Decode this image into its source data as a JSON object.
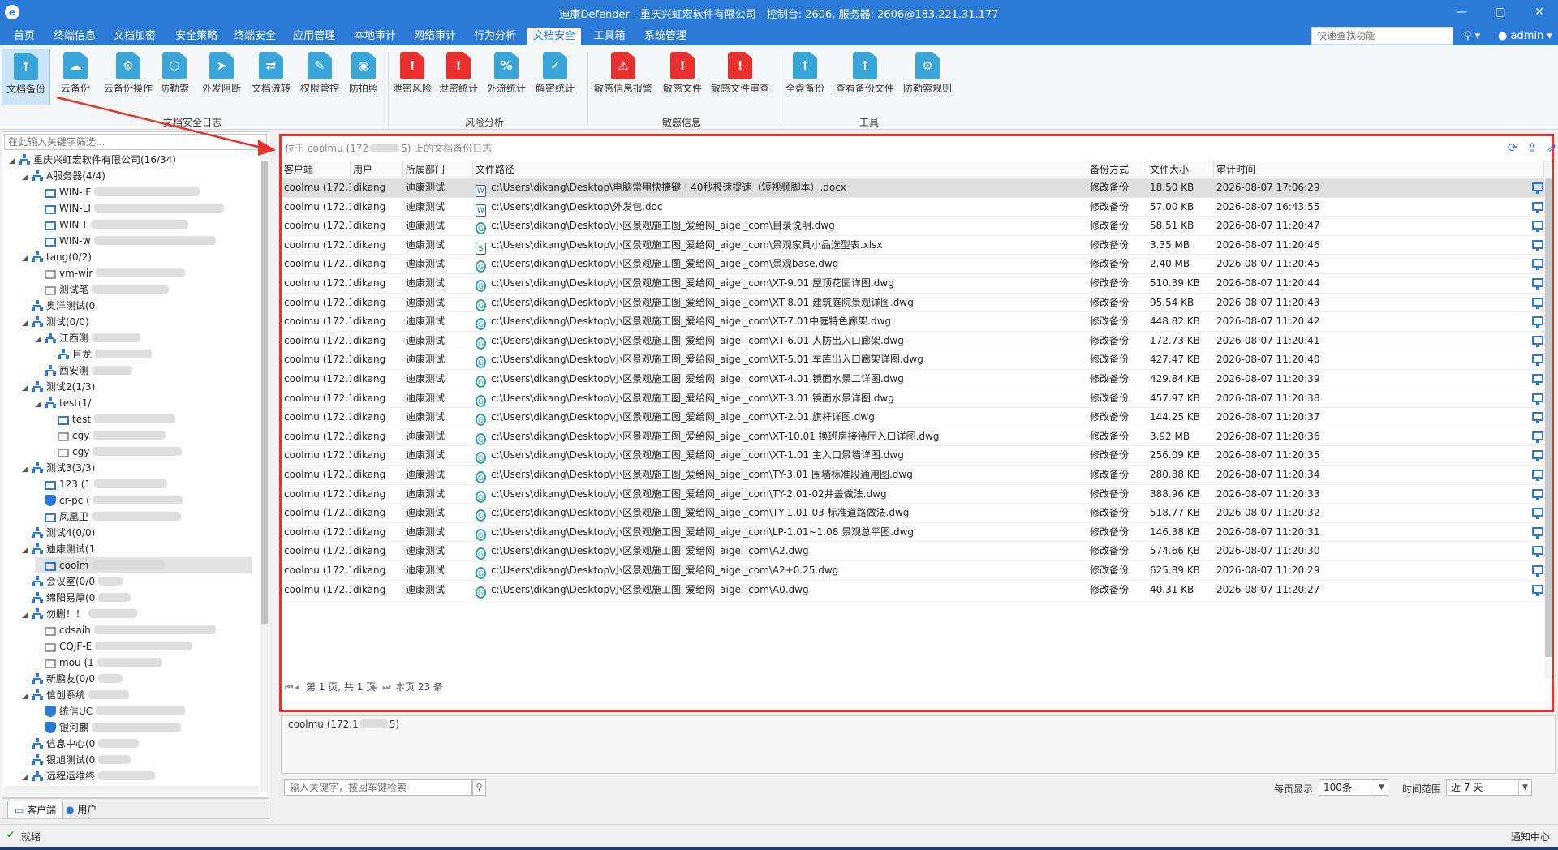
{
  "window": {
    "title": "迪康Defender - 重庆兴虹宏软件有限公司 - 控制台: 2606, 服务器: 2606@183.221.31.177"
  },
  "menu": {
    "items": [
      "首页",
      "终端信息",
      "文档加密",
      "安全策略",
      "终端安全",
      "应用管理",
      "本地审计",
      "网络审计",
      "行为分析",
      "文档安全",
      "工具箱",
      "系统管理"
    ],
    "active_index": 9,
    "quick_search_placeholder": "快速查找功能",
    "user": "admin"
  },
  "ribbon": {
    "groups": [
      {
        "label": "文档安全日志",
        "buttons": [
          "文档备份",
          "云备份",
          "云备份操作",
          "防勒索",
          "外发阻断",
          "文档流转",
          "权限管控",
          "防拍照"
        ]
      },
      {
        "label": "风险分析",
        "buttons": [
          "泄密风险",
          "泄密统计",
          "外流统计",
          "解密统计"
        ]
      },
      {
        "label": "敏感信息",
        "buttons": [
          "敏感信息报警",
          "敏感文件",
          "敏感文件审查"
        ]
      },
      {
        "label": "工具",
        "buttons": [
          "全盘备份",
          "查看备份文件",
          "防勒索规则"
        ]
      }
    ],
    "active_button": "文档备份",
    "colors": {
      "accent": "#2b79d6",
      "alert": "#e8312f",
      "teal": "#3aa5d8"
    }
  },
  "tree": {
    "filter_placeholder": "在此输入关键字筛选...",
    "nodes": [
      {
        "label": "重庆兴虹宏软件有限公司(16/34)",
        "level": 0,
        "type": "org",
        "toggle": "▲"
      },
      {
        "label": "A服务器(4/4)",
        "level": 1,
        "type": "org",
        "toggle": "▲"
      },
      {
        "label": "WIN-IF",
        "level": 2,
        "type": "pc"
      },
      {
        "label": "WIN-LI",
        "level": 2,
        "type": "pc"
      },
      {
        "label": "WIN-T",
        "level": 2,
        "type": "pc"
      },
      {
        "label": "WIN-w",
        "level": 2,
        "type": "pc"
      },
      {
        "label": "tang(0/2)",
        "level": 1,
        "type": "org",
        "toggle": "▲"
      },
      {
        "label": "vm-wir",
        "level": 2,
        "type": "pc-off"
      },
      {
        "label": "测试笔",
        "level": 2,
        "type": "pc-off"
      },
      {
        "label": "奥洋测试(0",
        "level": 1,
        "type": "org"
      },
      {
        "label": "测试(0/0)",
        "level": 1,
        "type": "org",
        "toggle": "▲"
      },
      {
        "label": "江西测",
        "level": 2,
        "type": "org",
        "toggle": "▲"
      },
      {
        "label": "巨龙",
        "level": 3,
        "type": "org"
      },
      {
        "label": "西安测",
        "level": 2,
        "type": "org"
      },
      {
        "label": "测试2(1/3)",
        "level": 1,
        "type": "org",
        "toggle": "▲"
      },
      {
        "label": "test(1/",
        "level": 2,
        "type": "org",
        "toggle": "▲"
      },
      {
        "label": "test",
        "level": 3,
        "type": "pc"
      },
      {
        "label": "cgy",
        "level": 3,
        "type": "pc-off"
      },
      {
        "label": "cgy",
        "level": 3,
        "type": "pc-off"
      },
      {
        "label": "测试3(3/3)",
        "level": 1,
        "type": "org",
        "toggle": "▲"
      },
      {
        "label": "123 (1",
        "level": 2,
        "type": "pc"
      },
      {
        "label": "cr-pc (",
        "level": 2,
        "type": "shield"
      },
      {
        "label": "凤凰卫",
        "level": 2,
        "type": "pc"
      },
      {
        "label": "测试4(0/0)",
        "level": 1,
        "type": "org"
      },
      {
        "label": "迪康测试(1",
        "level": 1,
        "type": "org",
        "toggle": "▲"
      },
      {
        "label": "coolm",
        "level": 2,
        "type": "pc",
        "selected": true
      },
      {
        "label": "会议室(0/0",
        "level": 1,
        "type": "org"
      },
      {
        "label": "绵阳易厚(0",
        "level": 1,
        "type": "org"
      },
      {
        "label": "勿删！！",
        "level": 1,
        "type": "org",
        "toggle": "▲"
      },
      {
        "label": "cdsaih",
        "level": 2,
        "type": "pc-off"
      },
      {
        "label": "CQJF-E",
        "level": 2,
        "type": "pc-off"
      },
      {
        "label": "mou (1",
        "level": 2,
        "type": "pc-off"
      },
      {
        "label": "新鹏友(0/0",
        "level": 1,
        "type": "org"
      },
      {
        "label": "信创系统",
        "level": 1,
        "type": "org",
        "toggle": "▲"
      },
      {
        "label": "统信UC",
        "level": 2,
        "type": "shield"
      },
      {
        "label": "银河麒",
        "level": 2,
        "type": "shield"
      },
      {
        "label": "信息中心(0",
        "level": 1,
        "type": "org"
      },
      {
        "label": "银旭测试(0",
        "level": 1,
        "type": "org"
      },
      {
        "label": "远程运维终",
        "level": 1,
        "type": "org",
        "toggle": "▲"
      }
    ]
  },
  "left_tabs": [
    "客户端",
    "用户"
  ],
  "grid": {
    "caption_left": "位于 coolmu (172",
    "caption_right": "5) 上的文档备份日志",
    "columns": [
      "客户端",
      "用户",
      "所属部门",
      "文件路径",
      "备份方式",
      "文件大小",
      "审计时间"
    ],
    "rows": [
      {
        "client": "coolmu (172.1...",
        "user": "dikang",
        "dept": "迪康测试",
        "ft": "w",
        "path": "c:\\Users\\dikang\\Desktop\\电脑常用快捷键｜40秒极速提速（短视频脚本）.docx",
        "mode": "修改备份",
        "size": "18.50 KB",
        "time": "2026-08-07 17:06:29"
      },
      {
        "client": "coolmu (172.1...",
        "user": "dikang",
        "dept": "迪康测试",
        "ft": "w",
        "path": "c:\\Users\\dikang\\Desktop\\外发包.doc",
        "mode": "修改备份",
        "size": "57.00 KB",
        "time": "2026-08-07 16:43:55"
      },
      {
        "client": "coolmu (172.1...",
        "user": "dikang",
        "dept": "迪康测试",
        "ft": "d",
        "path": "c:\\Users\\dikang\\Desktop\\小区景观施工图_爱给网_aigei_com\\目录说明.dwg",
        "mode": "修改备份",
        "size": "58.51 KB",
        "time": "2026-08-07 11:20:47"
      },
      {
        "client": "coolmu (172.1...",
        "user": "dikang",
        "dept": "迪康测试",
        "ft": "x",
        "path": "c:\\Users\\dikang\\Desktop\\小区景观施工图_爱给网_aigei_com\\景观家具小品选型表.xlsx",
        "mode": "修改备份",
        "size": "3.35 MB",
        "time": "2026-08-07 11:20:46"
      },
      {
        "client": "coolmu (172.1...",
        "user": "dikang",
        "dept": "迪康测试",
        "ft": "d",
        "path": "c:\\Users\\dikang\\Desktop\\小区景观施工图_爱给网_aigei_com\\景观base.dwg",
        "mode": "修改备份",
        "size": "2.40 MB",
        "time": "2026-08-07 11:20:45"
      },
      {
        "client": "coolmu (172.1...",
        "user": "dikang",
        "dept": "迪康测试",
        "ft": "d",
        "path": "c:\\Users\\dikang\\Desktop\\小区景观施工图_爱给网_aigei_com\\XT-9.01 屋顶花园详图.dwg",
        "mode": "修改备份",
        "size": "510.39 KB",
        "time": "2026-08-07 11:20:44"
      },
      {
        "client": "coolmu (172.1...",
        "user": "dikang",
        "dept": "迪康测试",
        "ft": "d",
        "path": "c:\\Users\\dikang\\Desktop\\小区景观施工图_爱给网_aigei_com\\XT-8.01 建筑庭院景观详图.dwg",
        "mode": "修改备份",
        "size": "95.54 KB",
        "time": "2026-08-07 11:20:43"
      },
      {
        "client": "coolmu (172.1...",
        "user": "dikang",
        "dept": "迪康测试",
        "ft": "d",
        "path": "c:\\Users\\dikang\\Desktop\\小区景观施工图_爱给网_aigei_com\\XT-7.01中庭特色廊架.dwg",
        "mode": "修改备份",
        "size": "448.82 KB",
        "time": "2026-08-07 11:20:42"
      },
      {
        "client": "coolmu (172.1...",
        "user": "dikang",
        "dept": "迪康测试",
        "ft": "d",
        "path": "c:\\Users\\dikang\\Desktop\\小区景观施工图_爱给网_aigei_com\\XT-6.01 人防出入口廊架.dwg",
        "mode": "修改备份",
        "size": "172.73 KB",
        "time": "2026-08-07 11:20:41"
      },
      {
        "client": "coolmu (172.1...",
        "user": "dikang",
        "dept": "迪康测试",
        "ft": "d",
        "path": "c:\\Users\\dikang\\Desktop\\小区景观施工图_爱给网_aigei_com\\XT-5.01 车库出入口廊架详图.dwg",
        "mode": "修改备份",
        "size": "427.47 KB",
        "time": "2026-08-07 11:20:40"
      },
      {
        "client": "coolmu (172.1...",
        "user": "dikang",
        "dept": "迪康测试",
        "ft": "d",
        "path": "c:\\Users\\dikang\\Desktop\\小区景观施工图_爱给网_aigei_com\\XT-4.01 镜面水景二详图.dwg",
        "mode": "修改备份",
        "size": "429.84 KB",
        "time": "2026-08-07 11:20:39"
      },
      {
        "client": "coolmu (172.1...",
        "user": "dikang",
        "dept": "迪康测试",
        "ft": "d",
        "path": "c:\\Users\\dikang\\Desktop\\小区景观施工图_爱给网_aigei_com\\XT-3.01 镜面水景详图.dwg",
        "mode": "修改备份",
        "size": "457.97 KB",
        "time": "2026-08-07 11:20:38"
      },
      {
        "client": "coolmu (172.1...",
        "user": "dikang",
        "dept": "迪康测试",
        "ft": "d",
        "path": "c:\\Users\\dikang\\Desktop\\小区景观施工图_爱给网_aigei_com\\XT-2.01 旗杆详图.dwg",
        "mode": "修改备份",
        "size": "144.25 KB",
        "time": "2026-08-07 11:20:37"
      },
      {
        "client": "coolmu (172.1...",
        "user": "dikang",
        "dept": "迪康测试",
        "ft": "d",
        "path": "c:\\Users\\dikang\\Desktop\\小区景观施工图_爱给网_aigei_com\\XT-10.01 换班房接待厅入口详图.dwg",
        "mode": "修改备份",
        "size": "3.92 MB",
        "time": "2026-08-07 11:20:36"
      },
      {
        "client": "coolmu (172.1...",
        "user": "dikang",
        "dept": "迪康测试",
        "ft": "d",
        "path": "c:\\Users\\dikang\\Desktop\\小区景观施工图_爱给网_aigei_com\\XT-1.01 主入口景墙详图.dwg",
        "mode": "修改备份",
        "size": "256.09 KB",
        "time": "2026-08-07 11:20:35"
      },
      {
        "client": "coolmu (172.1...",
        "user": "dikang",
        "dept": "迪康测试",
        "ft": "d",
        "path": "c:\\Users\\dikang\\Desktop\\小区景观施工图_爱给网_aigei_com\\TY-3.01 围墙标准段通用图.dwg",
        "mode": "修改备份",
        "size": "280.88 KB",
        "time": "2026-08-07 11:20:34"
      },
      {
        "client": "coolmu (172.1...",
        "user": "dikang",
        "dept": "迪康测试",
        "ft": "d",
        "path": "c:\\Users\\dikang\\Desktop\\小区景观施工图_爱给网_aigei_com\\TY-2.01-02井盖做法.dwg",
        "mode": "修改备份",
        "size": "388.96 KB",
        "time": "2026-08-07 11:20:33"
      },
      {
        "client": "coolmu (172.1...",
        "user": "dikang",
        "dept": "迪康测试",
        "ft": "d",
        "path": "c:\\Users\\dikang\\Desktop\\小区景观施工图_爱给网_aigei_com\\TY-1.01-03 标准道路做法.dwg",
        "mode": "修改备份",
        "size": "518.77 KB",
        "time": "2026-08-07 11:20:32"
      },
      {
        "client": "coolmu (172.1...",
        "user": "dikang",
        "dept": "迪康测试",
        "ft": "d",
        "path": "c:\\Users\\dikang\\Desktop\\小区景观施工图_爱给网_aigei_com\\LP-1.01~1.08 景观总平图.dwg",
        "mode": "修改备份",
        "size": "146.38 KB",
        "time": "2026-08-07 11:20:31"
      },
      {
        "client": "coolmu (172.1...",
        "user": "dikang",
        "dept": "迪康测试",
        "ft": "d",
        "path": "c:\\Users\\dikang\\Desktop\\小区景观施工图_爱给网_aigei_com\\A2.dwg",
        "mode": "修改备份",
        "size": "574.66 KB",
        "time": "2026-08-07 11:20:30"
      },
      {
        "client": "coolmu (172.1...",
        "user": "dikang",
        "dept": "迪康测试",
        "ft": "d",
        "path": "c:\\Users\\dikang\\Desktop\\小区景观施工图_爱给网_aigei_com\\A2+0.25.dwg",
        "mode": "修改备份",
        "size": "625.89 KB",
        "time": "2026-08-07 11:20:29"
      },
      {
        "client": "coolmu (172.1...",
        "user": "dikang",
        "dept": "迪康测试",
        "ft": "d",
        "path": "c:\\Users\\dikang\\Desktop\\小区景观施工图_爱给网_aigei_com\\A0.dwg",
        "mode": "修改备份",
        "size": "40.31 KB",
        "time": "2026-08-07 11:20:27"
      }
    ]
  },
  "pager": {
    "page_text": "第 1 页, 共 1 页",
    "count_text": "本页 23 条"
  },
  "detail": {
    "text_left": "coolmu (172.1",
    "text_right": "5)"
  },
  "bottom": {
    "keyword_placeholder": "输入关键字，按回车键检索",
    "per_page_label": "每页显示",
    "per_page_value": "100条",
    "range_label": "时间范围",
    "range_value": "近 7 天"
  },
  "status": {
    "left": "就绪",
    "right": "通知中心"
  }
}
